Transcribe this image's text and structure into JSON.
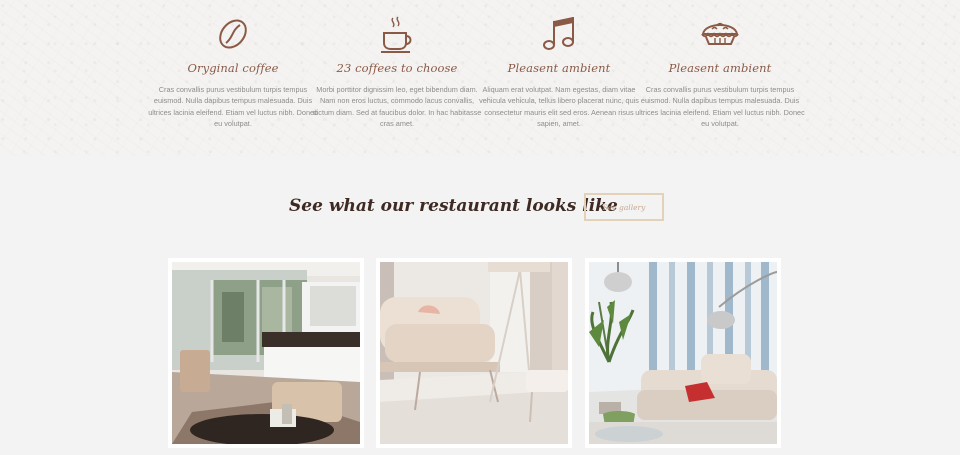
{
  "features": [
    {
      "title": "Oryginal coffee",
      "icon": "coffee-bean-icon",
      "text": "Cras convallis purus vestibulum turpis tempus euismod. Nulla dapibus tempus malesuada. Duis ultrices lacinia eleifend. Etiam vel luctus nibh. Donec eu volutpat."
    },
    {
      "title": "23 coffees to choose",
      "icon": "coffee-cup-icon",
      "text": "Morbi porttitor dignissim leo, eget bibendum diam. Nam non eros luctus, commodo lacus convallis, dictum diam. Sed at faucibus dolor. In hac habitasse cras amet."
    },
    {
      "title": "Pleasent ambient",
      "icon": "music-note-icon",
      "text": "Aliquam erat volutpat. Nam egestas, diam vitae vehicula vehicula, tellus libero placerat nunc, quis consectetur mauris elit sed eros. Aenean risus sapien, amet."
    },
    {
      "title": "Pleasent ambient",
      "icon": "pie-icon",
      "text": "Cras convallis purus vestibulum turpis tempus euismod. Nulla dapibus tempus malesuada. Duis ultrices lacinia eleifend. Etiam vel luctus nibh. Donec eu volutpat."
    }
  ],
  "gallery": {
    "title": "See what our restaurant looks like",
    "button_label": "See gallery"
  },
  "colors": {
    "accent": "#8a5a46",
    "button_border": "#e4d2b8",
    "heading": "#3e2a22"
  }
}
